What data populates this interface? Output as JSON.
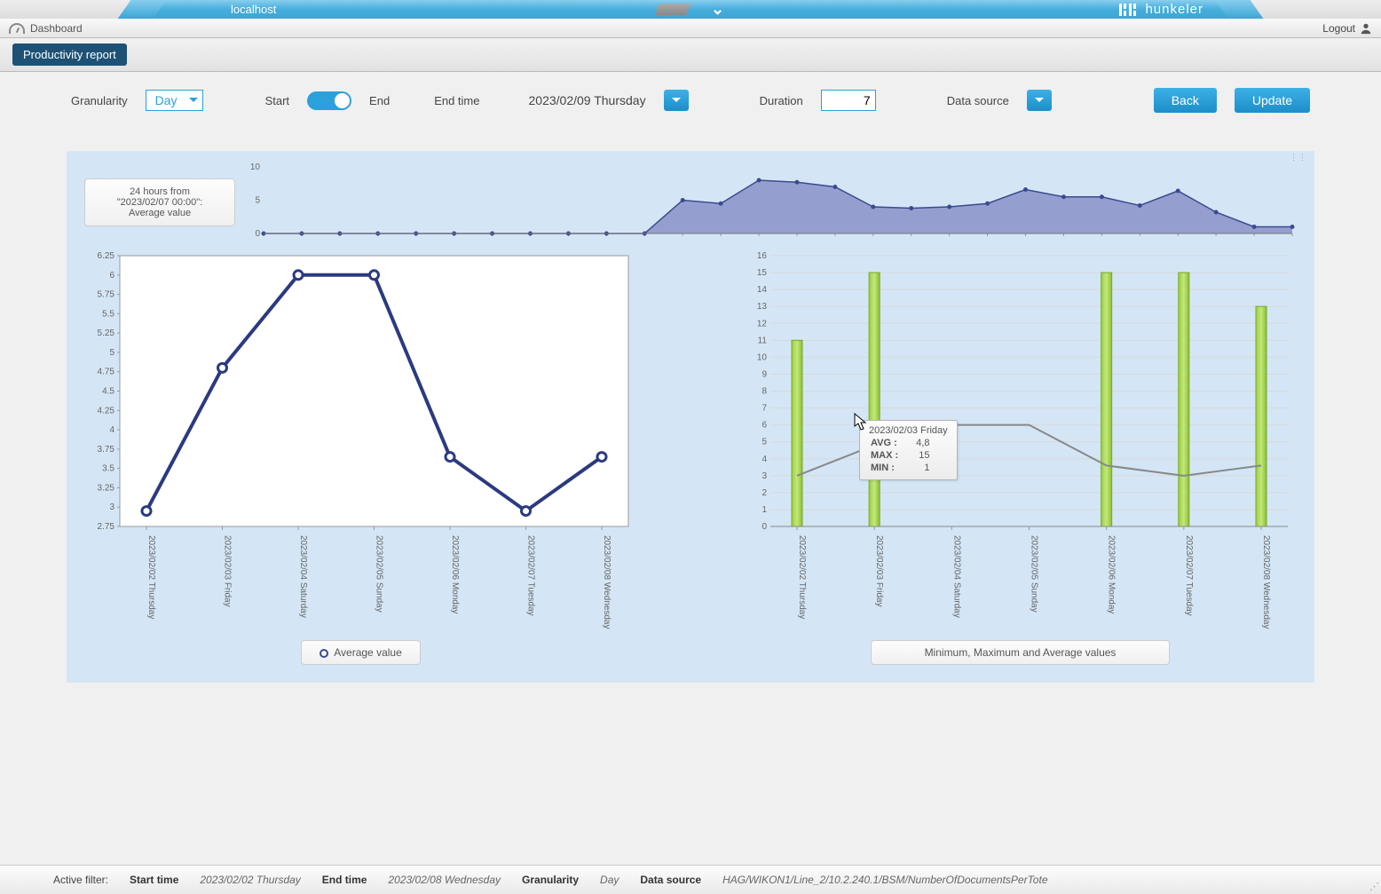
{
  "topbar": {
    "host": "localhost",
    "brand": "hunkeler"
  },
  "toolbar": {
    "dashboard": "Dashboard",
    "logout": "Logout"
  },
  "tab": {
    "title": "Productivity report"
  },
  "controls": {
    "granularity_label": "Granularity",
    "granularity_value": "Day",
    "start_label": "Start",
    "end_label": "End",
    "endtime_label": "End time",
    "endtime_value": "2023/02/09 Thursday",
    "duration_label": "Duration",
    "duration_value": "7",
    "datasource_label": "Data source",
    "back": "Back",
    "update": "Update"
  },
  "info_box": {
    "line1": "24 hours from",
    "line2": "\"2023/02/07 00:00\":",
    "line3": "Average value"
  },
  "legend_left": "Average value",
  "legend_right": "Minimum, Maximum and Average values",
  "tooltip": {
    "title": "2023/02/03 Friday",
    "avg_label": "AVG :",
    "avg_val": "4,8",
    "max_label": "MAX :",
    "max_val": "15",
    "min_label": "MIN :",
    "min_val": "1"
  },
  "footer": {
    "active_filter": "Active filter:",
    "start_label": "Start time",
    "start_val": "2023/02/02 Thursday",
    "end_label": "End time",
    "end_val": "2023/02/08 Wednesday",
    "gran_label": "Granularity",
    "gran_val": "Day",
    "ds_label": "Data source",
    "ds_val": "HAG/WIKON1/Line_2/10.2.240.1/BSM/NumberOfDocumentsPerTote"
  },
  "chart_data": [
    {
      "type": "area",
      "name": "hourly_overview",
      "ylim": [
        0,
        10
      ],
      "yticks": [
        0,
        5,
        10
      ],
      "x": [
        0,
        1,
        2,
        3,
        4,
        5,
        6,
        7,
        8,
        9,
        10,
        11,
        12,
        13,
        14,
        15,
        16,
        17,
        18,
        19,
        20,
        21,
        22,
        23,
        24,
        25,
        26,
        27
      ],
      "values": [
        0,
        0,
        0,
        0,
        0,
        0,
        0,
        0,
        0,
        0,
        0,
        5,
        4.5,
        8,
        7.7,
        7,
        4,
        3.8,
        4,
        4.5,
        6.6,
        5.5,
        5.5,
        4.2,
        6.4,
        3.2,
        1,
        1
      ]
    },
    {
      "type": "line",
      "name": "average_value",
      "categories": [
        "2023/02/02 Thursday",
        "2023/02/03 Friday",
        "2023/02/04 Saturday",
        "2023/02/05 Sunday",
        "2023/02/06 Monday",
        "2023/02/07 Tuesday",
        "2023/02/08 Wednesday"
      ],
      "values": [
        2.95,
        4.8,
        6.0,
        6.0,
        3.65,
        2.95,
        3.65
      ],
      "ylim": [
        2.75,
        6.25
      ],
      "yticks": [
        2.75,
        3,
        3.25,
        3.5,
        3.75,
        4,
        4.25,
        4.5,
        4.75,
        5,
        5.25,
        5.5,
        5.75,
        6,
        6.25
      ],
      "title": "Average value"
    },
    {
      "type": "bar",
      "name": "min_max_avg",
      "categories": [
        "2023/02/02 Thursday",
        "2023/02/03 Friday",
        "2023/02/04 Saturday",
        "2023/02/05 Sunday",
        "2023/02/06 Monday",
        "2023/02/07 Tuesday",
        "2023/02/08 Wednesday"
      ],
      "series": [
        {
          "name": "max",
          "values": [
            11,
            15,
            0,
            0,
            15,
            15,
            13
          ]
        },
        {
          "name": "avg",
          "values": [
            3.0,
            4.8,
            6.0,
            6.0,
            3.6,
            3.0,
            3.6
          ]
        },
        {
          "name": "min",
          "values": [
            1,
            1,
            0,
            0,
            1,
            1,
            1
          ]
        }
      ],
      "ylim": [
        0,
        16
      ],
      "yticks": [
        0,
        1,
        2,
        3,
        4,
        5,
        6,
        7,
        8,
        9,
        10,
        11,
        12,
        13,
        14,
        15,
        16
      ],
      "title": "Minimum, Maximum and Average values"
    }
  ]
}
